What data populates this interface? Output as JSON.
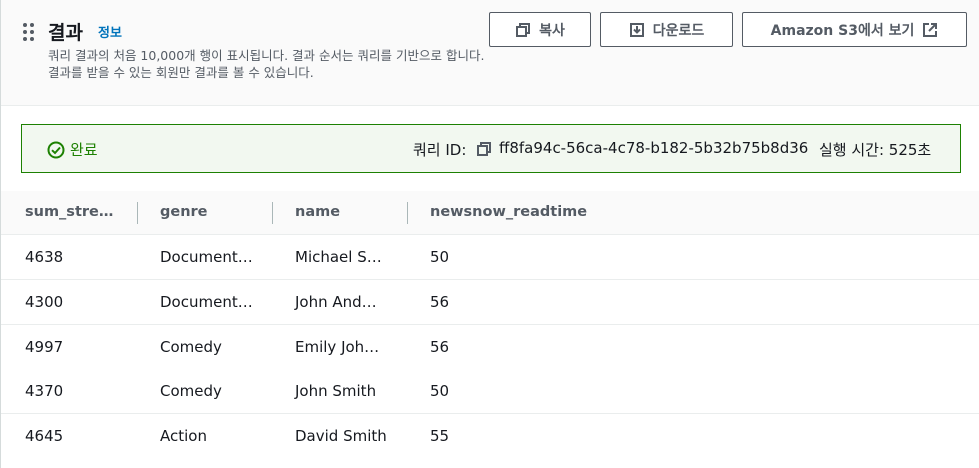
{
  "header": {
    "title": "결과",
    "info_link": "정보",
    "description": "쿼리 결과의 처음 10,000개 행이 표시됩니다. 결과 순서는 쿼리를 기반으로 합니다. 결과를 받을 수 있는 회원만 결과를 볼 수 있습니다.",
    "buttons": {
      "copy": "복사",
      "download": "다운로드",
      "view_s3": "Amazon S3에서 보기"
    }
  },
  "status": {
    "label": "완료",
    "query_id_label": "쿼리 ID:",
    "query_id": "ff8fa94c-56ca-4c78-b182-5b32b75b8d36",
    "runtime": "실행 시간: 525초",
    "color": "#1d8102"
  },
  "table": {
    "columns": [
      "sum_stre…",
      "genre",
      "name",
      "newsnow_readtime"
    ],
    "rows": [
      [
        "4638",
        "Document…",
        "Michael S…",
        "50"
      ],
      [
        "4300",
        "Document…",
        "John And…",
        "56"
      ],
      [
        "4997",
        "Comedy",
        "Emily Joh…",
        "56"
      ],
      [
        "4370",
        "Comedy",
        "John Smith",
        "50"
      ],
      [
        "4645",
        "Action",
        "David Smith",
        "55"
      ]
    ]
  },
  "icons": {
    "drag": "drag-handle-icon",
    "copy": "copy-icon",
    "download": "download-icon",
    "external": "external-link-icon",
    "success": "check-circle-icon"
  },
  "colors": {
    "link": "#0073bb",
    "success": "#1d8102",
    "button_text": "#545b64"
  }
}
